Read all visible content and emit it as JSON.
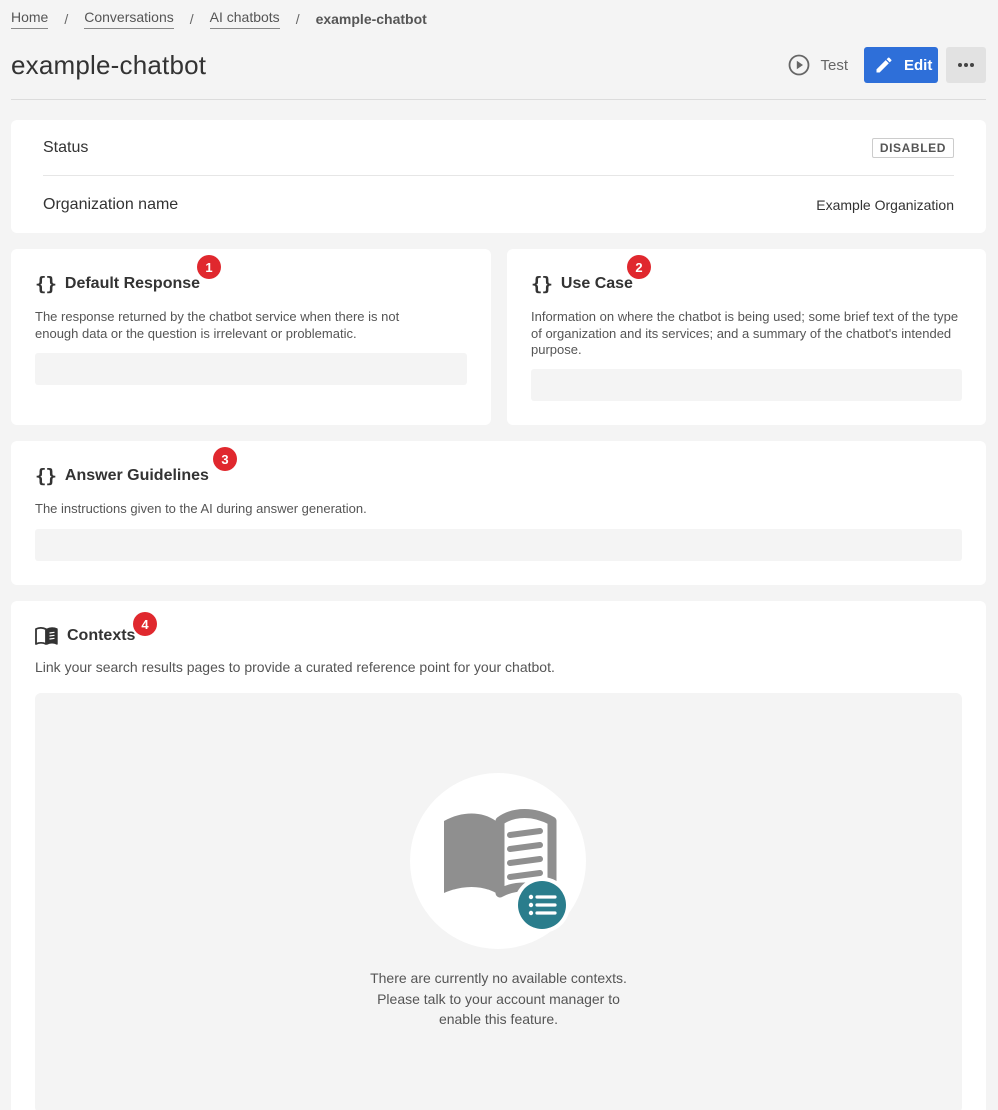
{
  "breadcrumb": {
    "items": [
      {
        "label": "Home"
      },
      {
        "label": "Conversations"
      },
      {
        "label": "AI chatbots"
      }
    ],
    "separator": "/",
    "current": "example-chatbot"
  },
  "header": {
    "title": "example-chatbot",
    "test_label": "Test",
    "edit_label": "Edit",
    "more_icon": "ellipsis-icon"
  },
  "status_card": {
    "status_label": "Status",
    "status_value": "DISABLED",
    "org_label": "Organization name",
    "org_value": "Example Organization"
  },
  "default_response": {
    "badge": "1",
    "title": "Default Response",
    "description": "The response returned by the chatbot service when there is not enough data or the question is irrelevant or problematic.",
    "value": ""
  },
  "use_case": {
    "badge": "2",
    "title": "Use Case",
    "description": "Information on where the chatbot is being used; some brief text of the type of organization and its services; and a summary of the chatbot's intended purpose.",
    "value": ""
  },
  "answer_guidelines": {
    "badge": "3",
    "title": "Answer Guidelines",
    "description": "The instructions given to the AI during answer generation.",
    "value": ""
  },
  "contexts": {
    "badge": "4",
    "title": "Contexts",
    "description": "Link your search results pages to provide a curated reference point for your chatbot.",
    "empty_lines": [
      "There are currently no available contexts.",
      "Please talk to your account manager to",
      "enable this feature."
    ]
  },
  "colors": {
    "primary": "#2e6fd9",
    "badge_red": "#e0282e",
    "teal": "#2a7d8c"
  }
}
